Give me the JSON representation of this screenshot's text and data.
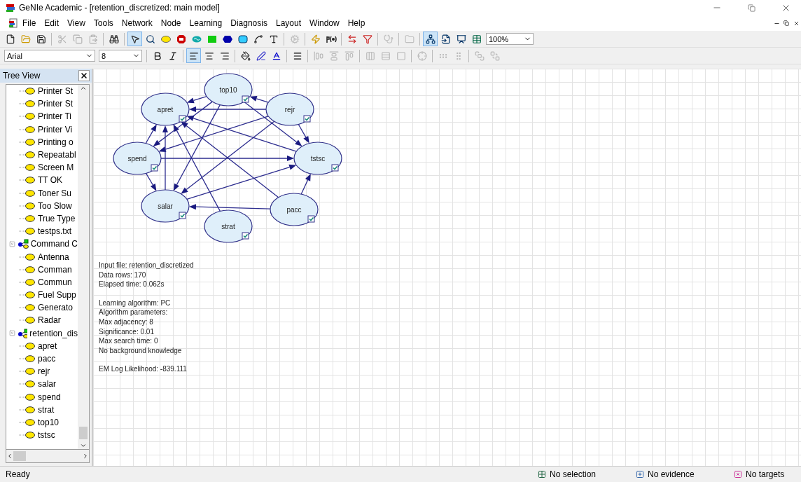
{
  "window": {
    "title": "GeNIe Academic - [retention_discretized: main model]"
  },
  "menu": [
    "File",
    "Edit",
    "View",
    "Tools",
    "Network",
    "Node",
    "Learning",
    "Diagnosis",
    "Layout",
    "Window",
    "Help"
  ],
  "toolbar": {
    "buttons": [
      {
        "kind": "new",
        "selected": false
      },
      {
        "kind": "open",
        "selected": false
      },
      {
        "kind": "save",
        "selected": false
      },
      {
        "kind": "sep"
      },
      {
        "kind": "cut",
        "selected": false,
        "disabled": true
      },
      {
        "kind": "copy",
        "selected": false,
        "disabled": true
      },
      {
        "kind": "paste",
        "selected": false,
        "disabled": true
      },
      {
        "kind": "sep"
      },
      {
        "kind": "find",
        "selected": false
      },
      {
        "kind": "sep"
      },
      {
        "kind": "pointer",
        "selected": true
      },
      {
        "kind": "zoom",
        "selected": false
      },
      {
        "kind": "chance",
        "selected": false
      },
      {
        "kind": "decision",
        "selected": false
      },
      {
        "kind": "equation",
        "selected": false
      },
      {
        "kind": "rect",
        "selected": false
      },
      {
        "kind": "hexagon",
        "selected": false
      },
      {
        "kind": "rounded",
        "selected": false
      },
      {
        "kind": "arc",
        "selected": false
      },
      {
        "kind": "text",
        "selected": false
      },
      {
        "kind": "sep"
      },
      {
        "kind": "gear",
        "selected": false,
        "disabled": true
      },
      {
        "kind": "sep"
      },
      {
        "kind": "update",
        "selected": false
      },
      {
        "kind": "probability",
        "selected": false
      },
      {
        "kind": "sep"
      },
      {
        "kind": "swap",
        "selected": false
      },
      {
        "kind": "funnel",
        "selected": false
      },
      {
        "kind": "sep"
      },
      {
        "kind": "diagnose",
        "selected": false,
        "disabled": true
      },
      {
        "kind": "sep"
      },
      {
        "kind": "folder",
        "selected": false,
        "disabled": true
      },
      {
        "kind": "sep"
      },
      {
        "kind": "tree",
        "selected": true
      },
      {
        "kind": "import",
        "selected": false
      },
      {
        "kind": "chart",
        "selected": false
      },
      {
        "kind": "table",
        "selected": false
      }
    ],
    "zoom": "100%"
  },
  "format_bar": {
    "font": "Arial",
    "size": "8",
    "buttons": [
      {
        "kind": "bold",
        "selected": false
      },
      {
        "kind": "italic",
        "selected": false
      },
      {
        "kind": "sep"
      },
      {
        "kind": "align-left",
        "selected": true
      },
      {
        "kind": "align-center",
        "selected": false
      },
      {
        "kind": "align-right",
        "selected": false
      },
      {
        "kind": "sep"
      },
      {
        "kind": "fill",
        "selected": false
      },
      {
        "kind": "line-color",
        "selected": false
      },
      {
        "kind": "font-color",
        "selected": false
      },
      {
        "kind": "sep"
      },
      {
        "kind": "line-width",
        "selected": false
      },
      {
        "kind": "sep"
      },
      {
        "kind": "align-h",
        "selected": false,
        "disabled": true
      },
      {
        "kind": "align-v",
        "selected": false,
        "disabled": true
      },
      {
        "kind": "align-top",
        "selected": false,
        "disabled": true
      },
      {
        "kind": "sep"
      },
      {
        "kind": "space-h",
        "selected": false,
        "disabled": true
      },
      {
        "kind": "space-v",
        "selected": false,
        "disabled": true
      },
      {
        "kind": "same-size",
        "selected": false,
        "disabled": true
      },
      {
        "kind": "sep"
      },
      {
        "kind": "center",
        "selected": false,
        "disabled": true
      },
      {
        "kind": "sep"
      },
      {
        "kind": "row",
        "selected": false,
        "disabled": true
      },
      {
        "kind": "column",
        "selected": false,
        "disabled": true
      },
      {
        "kind": "sep"
      },
      {
        "kind": "front",
        "selected": false,
        "disabled": true
      },
      {
        "kind": "back",
        "selected": false,
        "disabled": true
      }
    ]
  },
  "tree_view": {
    "title": "Tree View",
    "nodes": [
      {
        "kind": "continued",
        "children": [
          {
            "label": "Printer St"
          },
          {
            "label": "Printer St"
          },
          {
            "label": "Printer Ti"
          },
          {
            "label": "Printer Vi"
          },
          {
            "label": "Printing o"
          },
          {
            "label": "Repeatabl"
          },
          {
            "label": "Screen M"
          },
          {
            "label": "TT OK"
          },
          {
            "label": "Toner Su"
          },
          {
            "label": "Too Slow"
          },
          {
            "label": "True Type"
          },
          {
            "label": "testps.txt"
          }
        ]
      },
      {
        "kind": "network",
        "label": "Command C",
        "expanded": true,
        "children": [
          {
            "label": "Antenna"
          },
          {
            "label": "Comman"
          },
          {
            "label": "Commun"
          },
          {
            "label": "Fuel Supp"
          },
          {
            "label": "Generato"
          },
          {
            "label": "Radar"
          }
        ]
      },
      {
        "kind": "network",
        "label": "retention_dis",
        "expanded": true,
        "children": [
          {
            "label": "apret"
          },
          {
            "label": "pacc"
          },
          {
            "label": "rejr"
          },
          {
            "label": "salar"
          },
          {
            "label": "spend"
          },
          {
            "label": "strat"
          },
          {
            "label": "top10"
          },
          {
            "label": "tstsc"
          }
        ]
      }
    ]
  },
  "graph": {
    "nodes": [
      {
        "label": "top10",
        "checked": true
      },
      {
        "label": "apret",
        "checked": true
      },
      {
        "label": "rejr",
        "checked": true
      },
      {
        "label": "spend",
        "checked": true
      },
      {
        "label": "tstsc",
        "checked": true
      },
      {
        "label": "salar",
        "checked": true
      },
      {
        "label": "pacc",
        "checked": true
      },
      {
        "label": "strat",
        "checked": true
      }
    ]
  },
  "learning_info": [
    [
      "Input file: retention_discretized",
      "Data rows: 170",
      "Elapsed time: 0.062s"
    ],
    [
      "Learning algorithm: PC",
      "Algorithm parameters:",
      "Max adjacency: 8",
      "Significance: 0.01",
      "Max search time: 0",
      "No background knowledge"
    ],
    [
      "EM Log Likelihood: -839.111"
    ]
  ],
  "status_bar": {
    "message": "Ready",
    "selection": "No selection",
    "evidence": "No evidence",
    "targets": "No targets"
  }
}
